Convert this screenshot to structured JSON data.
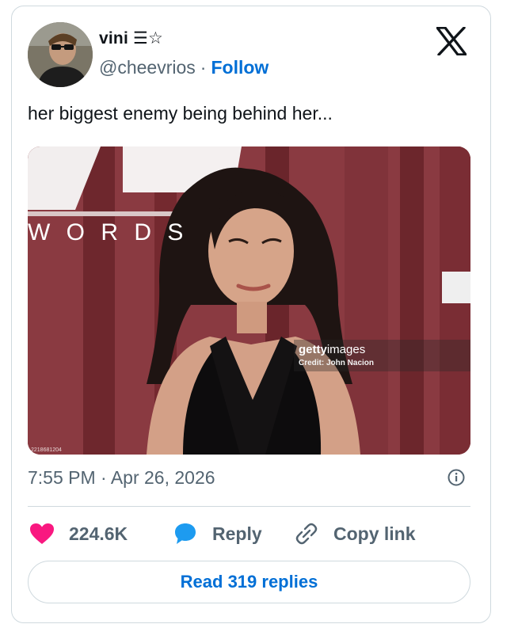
{
  "author": {
    "display_name": "vini ☰☆",
    "handle": "@cheevrios",
    "separator": "·",
    "follow_label": "Follow"
  },
  "brand": {
    "logo_icon": "x-logo-icon",
    "accent": "#006fd6"
  },
  "tweet": {
    "text": "her biggest enemy being behind her...",
    "timestamp": "7:55 PM · Apr 26, 2026"
  },
  "media": {
    "sign_text": "W O R D S",
    "watermark_brand_bold": "getty",
    "watermark_brand_light": "images",
    "watermark_credit": "Credit: John Nacion",
    "image_id": "2218681204"
  },
  "actions": {
    "like_count": "224.6K",
    "like_icon": "heart-icon",
    "like_color": "#f91880",
    "reply_label": "Reply",
    "reply_icon": "speech-bubble-icon",
    "reply_color": "#1d9bf0",
    "copy_label": "Copy link",
    "copy_icon": "link-icon",
    "info_icon": "info-icon"
  },
  "footer": {
    "read_replies_label": "Read 319 replies"
  }
}
